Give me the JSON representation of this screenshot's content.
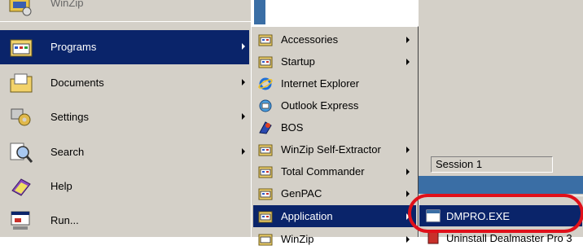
{
  "start_menu": {
    "top_label": "WinZip",
    "items": [
      {
        "label": "Programs",
        "icon": "programs-folder-icon",
        "has_submenu": true,
        "selected": true
      },
      {
        "label": "Documents",
        "icon": "documents-folder-icon",
        "has_submenu": true,
        "selected": false
      },
      {
        "label": "Settings",
        "icon": "settings-icon",
        "has_submenu": true,
        "selected": false
      },
      {
        "label": "Search",
        "icon": "search-icon",
        "has_submenu": true,
        "selected": false
      },
      {
        "label": "Help",
        "icon": "help-book-icon",
        "has_submenu": false,
        "selected": false
      },
      {
        "label": "Run...",
        "icon": "run-icon",
        "has_submenu": false,
        "selected": false
      }
    ]
  },
  "programs_menu": {
    "items": [
      {
        "label": "Accessories",
        "icon": "program-group-icon",
        "has_submenu": true,
        "selected": false
      },
      {
        "label": "Startup",
        "icon": "program-group-icon",
        "has_submenu": true,
        "selected": false
      },
      {
        "label": "Internet Explorer",
        "icon": "internet-explorer-icon",
        "has_submenu": false,
        "selected": false
      },
      {
        "label": "Outlook Express",
        "icon": "outlook-express-icon",
        "has_submenu": false,
        "selected": false
      },
      {
        "label": "BOS",
        "icon": "bos-icon",
        "has_submenu": false,
        "selected": false
      },
      {
        "label": "WinZip Self-Extractor",
        "icon": "program-group-icon",
        "has_submenu": true,
        "selected": false
      },
      {
        "label": "Total Commander",
        "icon": "program-group-icon",
        "has_submenu": true,
        "selected": false
      },
      {
        "label": "GenPAC",
        "icon": "program-group-icon",
        "has_submenu": true,
        "selected": false
      },
      {
        "label": "Application",
        "icon": "program-group-icon",
        "has_submenu": true,
        "selected": true
      },
      {
        "label": "WinZip",
        "icon": "program-group-icon",
        "has_submenu": true,
        "selected": false
      }
    ]
  },
  "background_window": {
    "session_label": "Session 1"
  },
  "application_menu": {
    "items": [
      {
        "label": "DMPRO.EXE",
        "icon": "executable-window-icon",
        "selected": true
      },
      {
        "label": "Uninstall Dealmaster Pro 3",
        "icon": "uninstall-icon",
        "selected": false
      }
    ]
  },
  "colors": {
    "menu_face": "#d4d0c8",
    "selection": "#0a246a",
    "highlight_ring": "#e0101a",
    "desktop_blue": "#3a6ea5"
  }
}
